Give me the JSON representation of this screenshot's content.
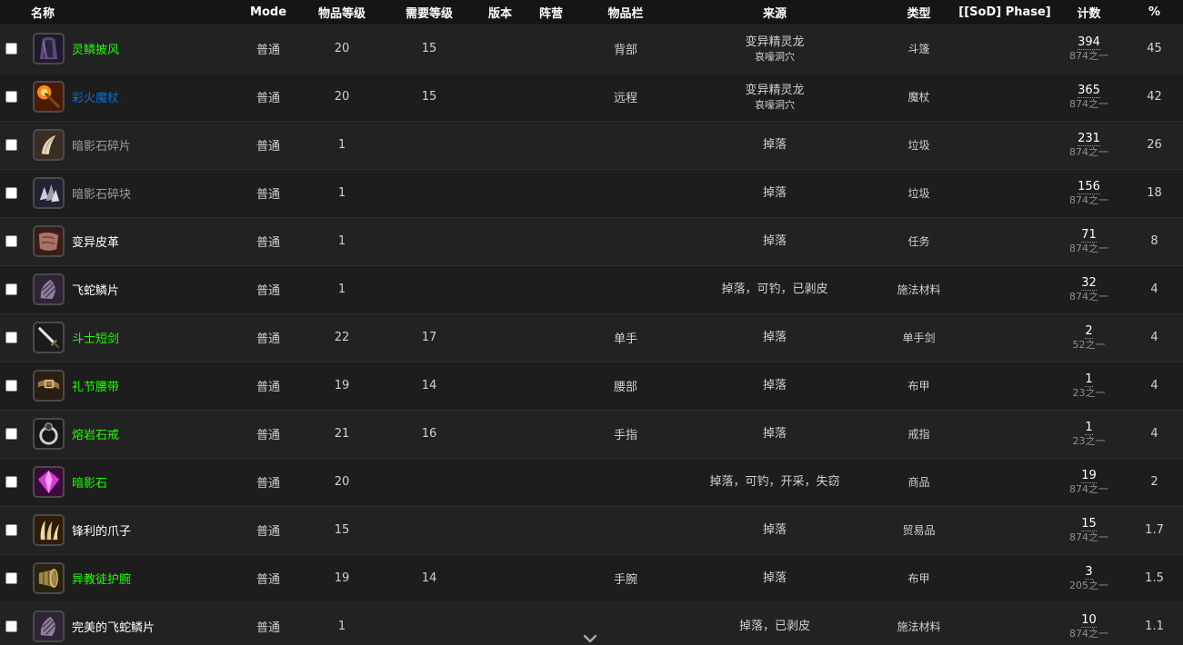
{
  "table": {
    "headers": {
      "name": "名称",
      "mode": "Mode",
      "ilvl": "物品等级",
      "req": "需要等级",
      "version": "版本",
      "side": "阵营",
      "slot": "物品栏",
      "source": "来源",
      "type": "类型",
      "phase": "[[SoD] Phase]",
      "count": "计数",
      "pct": "%"
    },
    "rows": [
      {
        "name": "灵鳞披风",
        "quality": "uncommon",
        "icon": "cloak-icon",
        "mode": "普通",
        "ilvl": "20",
        "req": "15",
        "slot": "背部",
        "source": "变异精灵龙",
        "source_sub": "哀嚎洞穴",
        "type": "斗篷",
        "count": "394",
        "count_of": "874之一",
        "pct": "45"
      },
      {
        "name": "彩火魔杖",
        "quality": "rare",
        "icon": "wand-icon",
        "mode": "普通",
        "ilvl": "20",
        "req": "15",
        "slot": "远程",
        "source": "变异精灵龙",
        "source_sub": "哀嚎洞穴",
        "type": "魔杖",
        "count": "365",
        "count_of": "874之一",
        "pct": "42"
      },
      {
        "name": "暗影石碎片",
        "quality": "poor",
        "icon": "fang-icon",
        "mode": "普通",
        "ilvl": "1",
        "req": "",
        "slot": "",
        "source": "掉落",
        "source_sub": "",
        "type": "垃圾",
        "count": "231",
        "count_of": "874之一",
        "pct": "26"
      },
      {
        "name": "暗影石碎块",
        "quality": "poor",
        "icon": "crystal-chunk-icon",
        "mode": "普通",
        "ilvl": "1",
        "req": "",
        "slot": "",
        "source": "掉落",
        "source_sub": "",
        "type": "垃圾",
        "count": "156",
        "count_of": "874之一",
        "pct": "18"
      },
      {
        "name": "变异皮革",
        "quality": "common",
        "icon": "leather-icon",
        "mode": "普通",
        "ilvl": "1",
        "req": "",
        "slot": "",
        "source": "掉落",
        "source_sub": "",
        "type": "任务",
        "count": "71",
        "count_of": "874之一",
        "pct": "8"
      },
      {
        "name": "飞蛇鳞片",
        "quality": "common",
        "icon": "scale-icon",
        "mode": "普通",
        "ilvl": "1",
        "req": "",
        "slot": "",
        "source": "掉落，可钓，已剥皮",
        "source_sub": "",
        "type": "施法材料",
        "count": "32",
        "count_of": "874之一",
        "pct": "4"
      },
      {
        "name": "斗士短剑",
        "quality": "uncommon",
        "icon": "sword-icon",
        "mode": "普通",
        "ilvl": "22",
        "req": "17",
        "slot": "单手",
        "source": "掉落",
        "source_sub": "",
        "type": "单手剑",
        "count": "2",
        "count_of": "52之一",
        "pct": "4"
      },
      {
        "name": "礼节腰带",
        "quality": "uncommon",
        "icon": "belt-icon",
        "mode": "普通",
        "ilvl": "19",
        "req": "14",
        "slot": "腰部",
        "source": "掉落",
        "source_sub": "",
        "type": "布甲",
        "count": "1",
        "count_of": "23之一",
        "pct": "4"
      },
      {
        "name": "熔岩石戒",
        "quality": "uncommon",
        "icon": "ring-icon",
        "mode": "普通",
        "ilvl": "21",
        "req": "16",
        "slot": "手指",
        "source": "掉落",
        "source_sub": "",
        "type": "戒指",
        "count": "1",
        "count_of": "23之一",
        "pct": "4"
      },
      {
        "name": "暗影石",
        "quality": "uncommon",
        "icon": "gem-icon",
        "mode": "普通",
        "ilvl": "20",
        "req": "",
        "slot": "",
        "source": "掉落，可钓，开采，失窃",
        "source_sub": "",
        "type": "商品",
        "count": "19",
        "count_of": "874之一",
        "pct": "2"
      },
      {
        "name": "锋利的爪子",
        "quality": "common",
        "icon": "claw-icon",
        "mode": "普通",
        "ilvl": "15",
        "req": "",
        "slot": "",
        "source": "掉落",
        "source_sub": "",
        "type": "贸易品",
        "count": "15",
        "count_of": "874之一",
        "pct": "1.7"
      },
      {
        "name": "异教徒护腕",
        "quality": "uncommon",
        "icon": "bracer-icon",
        "mode": "普通",
        "ilvl": "19",
        "req": "14",
        "slot": "手腕",
        "source": "掉落",
        "source_sub": "",
        "type": "布甲",
        "count": "3",
        "count_of": "205之一",
        "pct": "1.5"
      },
      {
        "name": "完美的飞蛇鳞片",
        "quality": "common",
        "icon": "scale-icon",
        "mode": "普通",
        "ilvl": "1",
        "req": "",
        "slot": "",
        "source": "掉落，已剥皮",
        "source_sub": "",
        "type": "施法材料",
        "count": "10",
        "count_of": "874之一",
        "pct": "1.1"
      }
    ]
  },
  "scroll_icon": "chevron-down-icon",
  "colors": {
    "uncommon": "#1eff00",
    "rare": "#0070dd",
    "poor": "#9d9d9d",
    "common": "#ffffff"
  }
}
